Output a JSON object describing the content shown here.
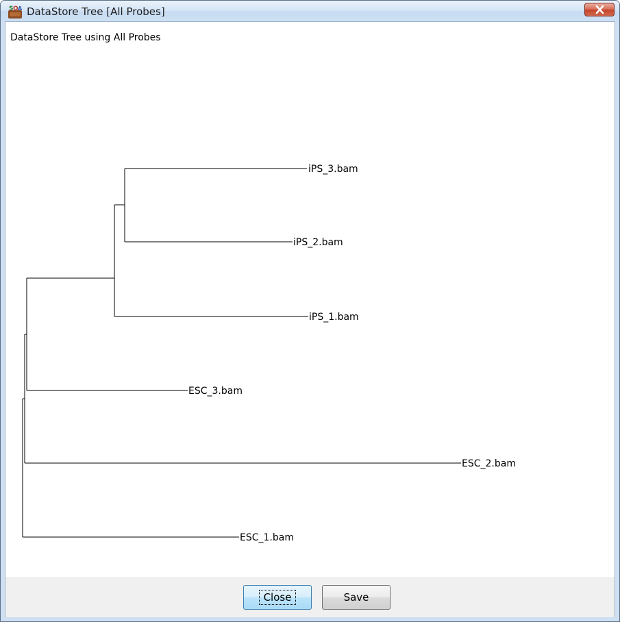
{
  "window": {
    "title": "DataStore Tree [All Probes]",
    "icon": "seqmonk-app-icon"
  },
  "panel": {
    "title": "DataStore Tree using All Probes"
  },
  "tree": {
    "leaves": [
      "iPS_3.bam",
      "iPS_2.bam",
      "iPS_1.bam",
      "ESC_3.bam",
      "ESC_2.bam",
      "ESC_1.bam"
    ]
  },
  "buttons": {
    "close_label": "Close",
    "save_label": "Save"
  }
}
